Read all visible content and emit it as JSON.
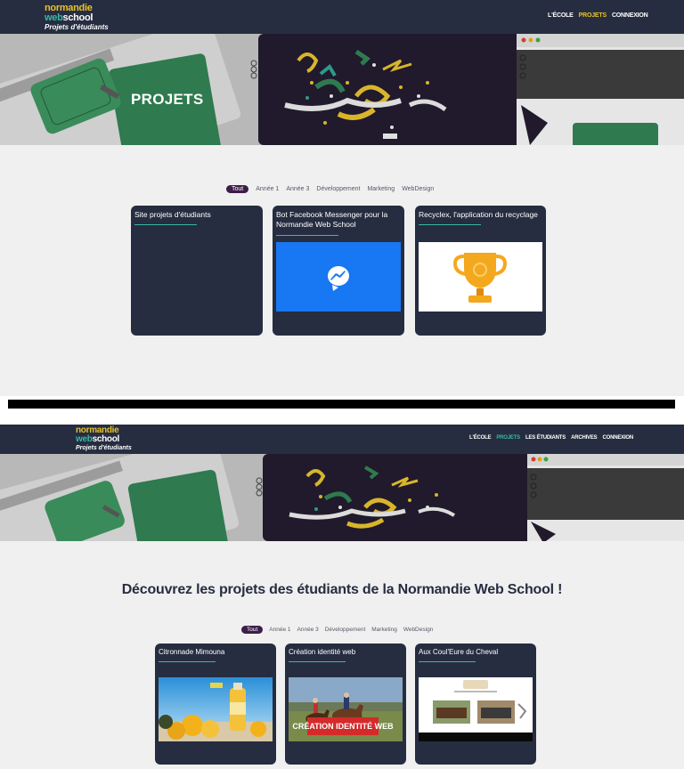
{
  "logo": {
    "line1": "normandie",
    "line2_a": "web",
    "line2_b": "school",
    "tagline": "Projets d'étudiants"
  },
  "colors": {
    "navbar": "#262d40",
    "accent_yellow": "#e8c12a",
    "accent_teal": "#37b9a6",
    "filter_active": "#3d1d4a",
    "card": "#262d40",
    "page_bg": "#f0f0f0"
  },
  "screen1": {
    "nav": [
      "L'ÉCOLE",
      "PROJETS",
      "CONNEXION"
    ],
    "hero_title": "PROJETS",
    "filters": [
      "Tout",
      "Année 1",
      "Année 3",
      "Développement",
      "Marketing",
      "WebDesign"
    ],
    "cards": [
      {
        "title": "Site projets d'étudiants",
        "image": "none"
      },
      {
        "title": "Bot Facebook Messenger pour la Normandie Web School",
        "image": "messenger-icon"
      },
      {
        "title": "Recyclex, l'application du recyclage",
        "image": "trophy-icon"
      }
    ]
  },
  "screen2": {
    "nav": [
      "L'ÉCOLE",
      "PROJETS",
      "LES ÉTUDIANTS",
      "ARCHIVES",
      "CONNEXION"
    ],
    "heading": "Découvrez les projets des étudiants de la Normandie Web School !",
    "filters": [
      "Tout",
      "Année 1",
      "Année 3",
      "Développement",
      "Marketing",
      "WebDesign"
    ],
    "cards": [
      {
        "title": "Citronnade Mimouna",
        "image": "lemonade-photo"
      },
      {
        "title": "Création identité web",
        "image": "horse-riding-photo",
        "banner": "CRÉATION IDENTITÉ WEB"
      },
      {
        "title": "Aux Coul'Eure du Cheval",
        "image": "website-screenshot"
      }
    ]
  }
}
